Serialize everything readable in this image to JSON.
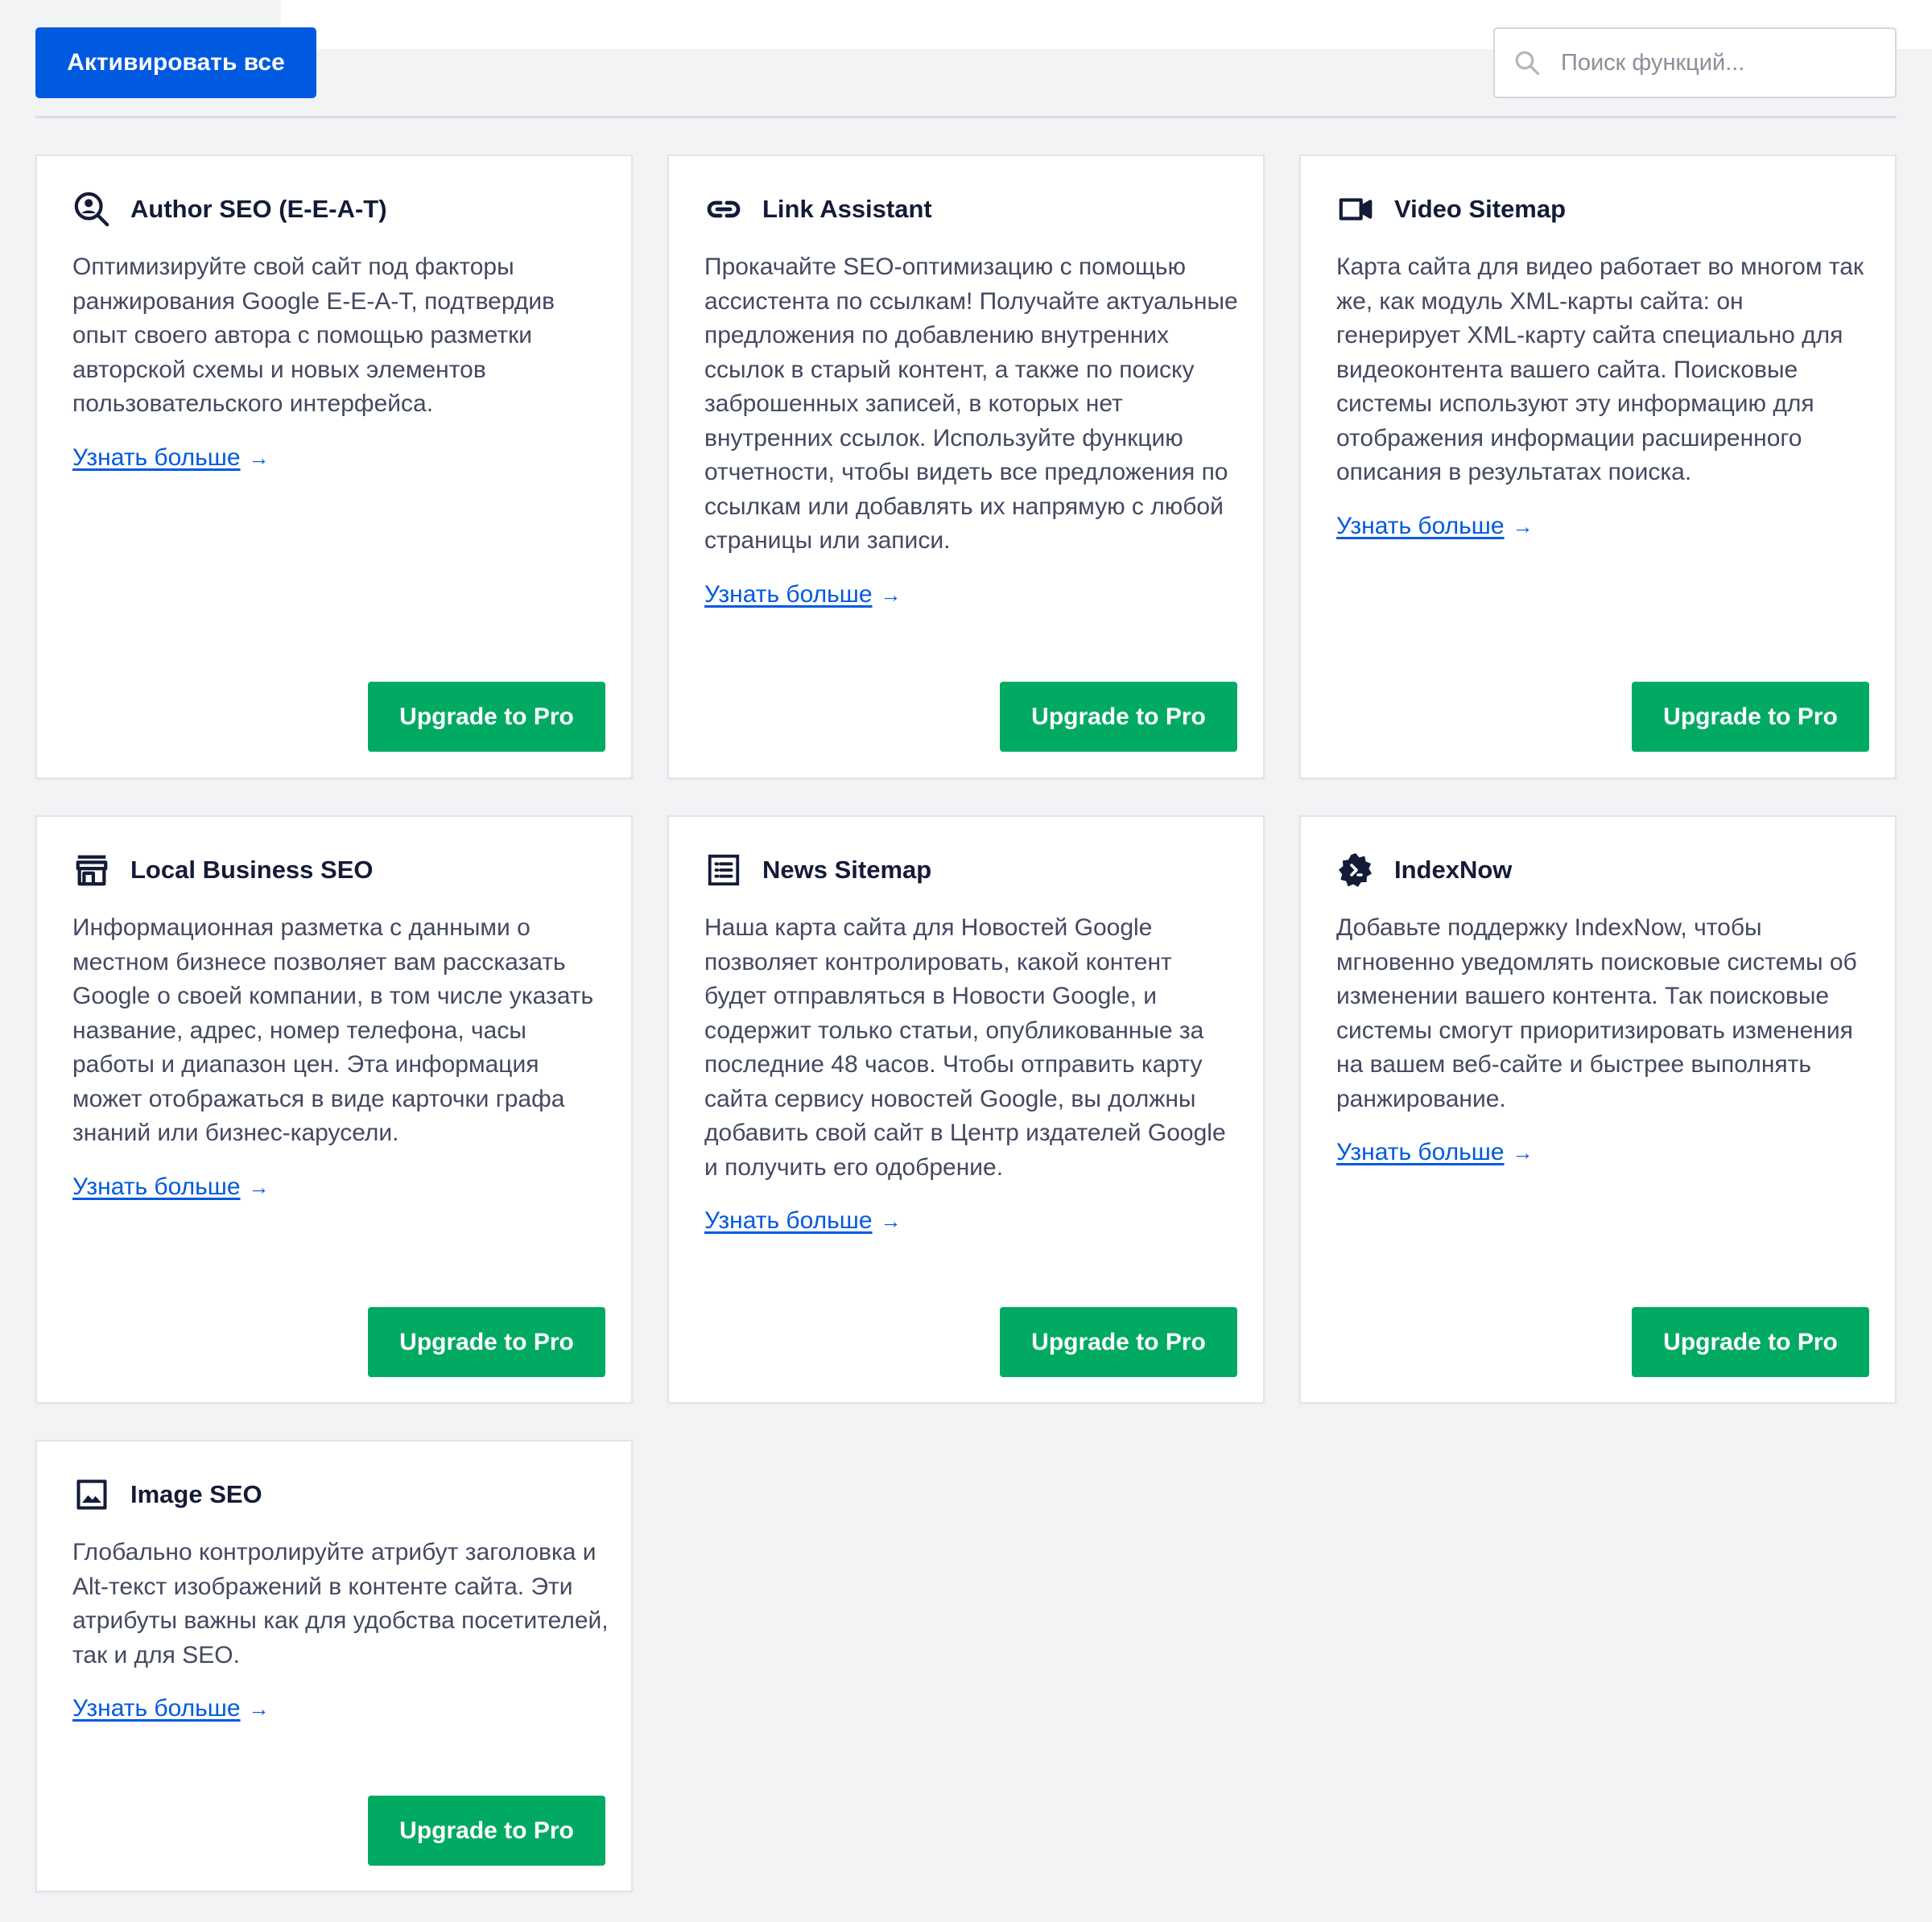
{
  "toolbar": {
    "activate_all_label": "Активировать все",
    "search_placeholder": "Поиск функций..."
  },
  "cards": [
    {
      "icon": "author-search-icon",
      "title": "Author SEO (E-E-A-T)",
      "description": "Оптимизируйте свой сайт под факторы ранжирования Google E-E-A-T, подтвердив опыт своего автора с помощью разметки авторской схемы и новых элементов пользовательского интерфейса.",
      "learn_more": "Узнать больше",
      "arrow": "→",
      "button": "Upgrade to Pro"
    },
    {
      "icon": "link-icon",
      "title": "Link Assistant",
      "description": "Прокачайте SEO-оптимизацию с помощью ассистента по ссылкам! Получайте актуальные предложения по добавлению внутренних ссылок в старый контент, а также по поиску заброшенных записей, в которых нет внутренних ссылок. Используйте функцию отчетности, чтобы видеть все предложения по ссылкам или добавлять их напрямую с любой страницы или записи.",
      "learn_more": "Узнать больше",
      "arrow": "→",
      "button": "Upgrade to Pro"
    },
    {
      "icon": "video-camera-icon",
      "title": "Video Sitemap",
      "description": "Карта сайта для видео работает во многом так же, как модуль XML-карты сайта: он генерирует XML-карту сайта специально для видеоконтента вашего сайта. Поисковые системы используют эту информацию для отображения информации расширенного описания в результатах поиска.",
      "learn_more": "Узнать больше",
      "arrow": "→",
      "button": "Upgrade to Pro"
    },
    {
      "icon": "storefront-icon",
      "title": "Local Business SEO",
      "description": "Информационная разметка с данными о местном бизнесе позволяет вам рассказать Google о своей компании, в том числе указать название, адрес, номер телефона, часы работы и диапазон цен. Эта информация может отображаться в виде карточки графа знаний или бизнес-карусели.",
      "learn_more": "Узнать больше",
      "arrow": "→",
      "button": "Upgrade to Pro"
    },
    {
      "icon": "news-list-icon",
      "title": "News Sitemap",
      "description": "Наша карта сайта для Новостей Google позволяет контролировать, какой контент будет отправляться в Новости Google, и содержит только статьи, опубликованные за последние 48 часов. Чтобы отправить карту сайта сервису новостей Google, вы должны добавить свой сайт в Центр издателей Google и получить его одобрение.",
      "learn_more": "Узнать больше",
      "arrow": "→",
      "button": "Upgrade to Pro"
    },
    {
      "icon": "indexnow-gear-icon",
      "title": "IndexNow",
      "description": "Добавьте поддержку IndexNow, чтобы мгновенно уведомлять поисковые системы об изменении вашего контента. Так поисковые системы смогут приоритизировать изменения на вашем веб-сайте и быстрее выполнять ранжирование.",
      "learn_more": "Узнать больше",
      "arrow": "→",
      "button": "Upgrade to Pro"
    },
    {
      "icon": "image-icon",
      "title": "Image SEO",
      "description": "Глобально контролируйте атрибут заголовка и Alt-текст изображений в контенте сайта. Эти атрибуты важны как для удобства посетителей, так и для SEO.",
      "learn_more": "Узнать больше",
      "arrow": "→",
      "button": "Upgrade to Pro"
    }
  ]
}
